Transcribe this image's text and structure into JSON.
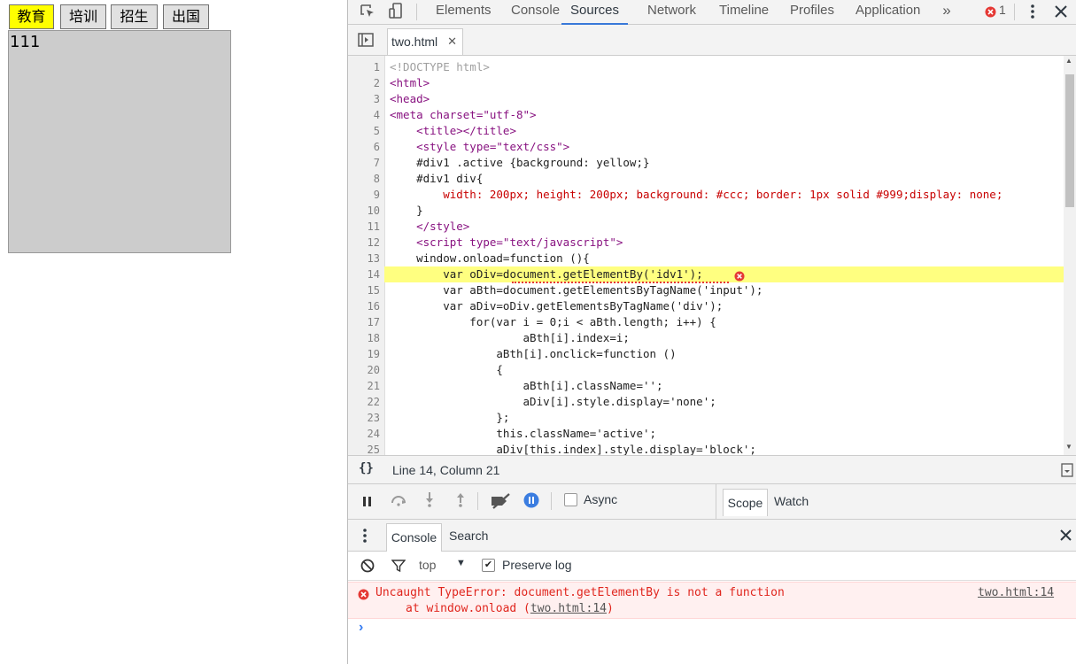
{
  "page": {
    "buttons": [
      {
        "label": "教育",
        "active": true
      },
      {
        "label": "培训",
        "active": false
      },
      {
        "label": "招生",
        "active": false
      },
      {
        "label": "出国",
        "active": false
      }
    ],
    "panel_text": "111"
  },
  "devtools": {
    "tabs": [
      "Elements",
      "Console",
      "Sources",
      "Network",
      "Timeline",
      "Profiles",
      "Application"
    ],
    "selected_tab": "Sources",
    "error_count": "1",
    "file_tab": "two.html",
    "line_numbers": [
      "1",
      "2",
      "3",
      "4",
      "5",
      "6",
      "7",
      "8",
      "9",
      "10",
      "11",
      "12",
      "13",
      "14",
      "15",
      "16",
      "17",
      "18",
      "19",
      "20",
      "21",
      "22",
      "23",
      "24",
      "25"
    ],
    "code_lines": [
      "<!DOCTYPE html>",
      "<html>",
      "<head>",
      "<meta charset=\"utf-8\">",
      "    <title></title>",
      "    <style type=\"text/css\">",
      "    #div1 .active {background: yellow;}",
      "    #div1 div{",
      "        width: 200px; height: 200px; background: #ccc; border: 1px solid #999;display: none;",
      "    }",
      "    </style>",
      "    <script type=\"text/javascript\">",
      "    window.onload=function (){",
      "        var oDiv=document.getElementBy('idv1');",
      "        var aBth=document.getElementsByTagName('input');",
      "        var aDiv=oDiv.getElementsByTagName('div');",
      "            for(var i = 0;i < aBth.length; i++) {",
      "                    aBth[i].index=i;",
      "                aBth[i].onclick=function ()",
      "                {",
      "                    aBth[i].className='';",
      "                    aDiv[i].style.display='none';",
      "                };",
      "                this.className='active';",
      "                aDiv[this.index].style.display='block';"
    ],
    "status_text": "Line 14, Column 21",
    "async_label": "Async",
    "scope_label": "Scope",
    "watch_label": "Watch",
    "console_tab": "Console",
    "search_tab": "Search",
    "context": "top",
    "preserve_log_label": "Preserve log",
    "error_message": "Uncaught TypeError: document.getElementBy is not a function",
    "error_at_prefix": "at window.onload (",
    "error_at_link": "two.html:14",
    "error_at_suffix": ")",
    "error_source": "two.html:14",
    "prompt": "›"
  }
}
